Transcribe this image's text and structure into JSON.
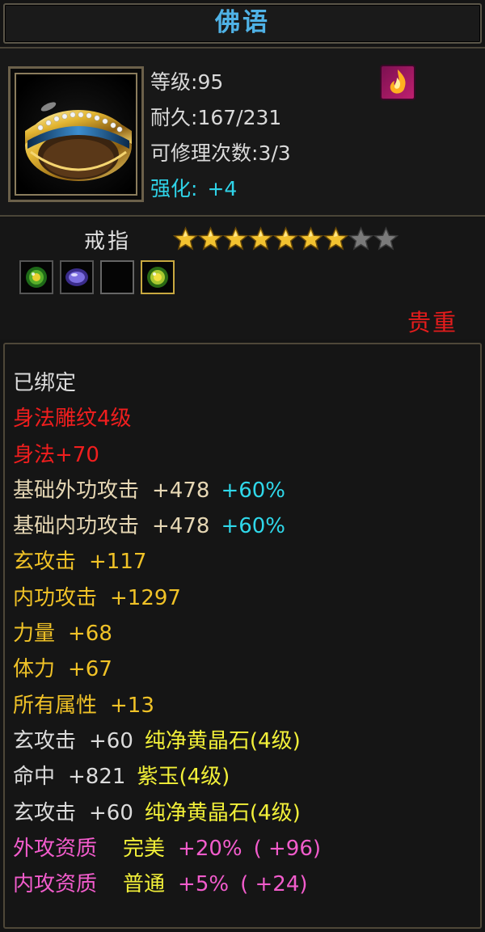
{
  "title": "佛语",
  "icons": {
    "item": "gold-ring-icon",
    "badge": "fire-skill-icon",
    "star_filled": "gold-star-icon",
    "star_empty": "gray-star-icon"
  },
  "stats": {
    "level_label": "等级",
    "level_value": "95",
    "durability_label": "耐久",
    "durability_value": "167/231",
    "repair_label": "可修理次数",
    "repair_value": "3/3",
    "enhance_label": "强化:",
    "enhance_value": "+4"
  },
  "item_type": "戒指",
  "stars": {
    "filled": 7,
    "total": 9
  },
  "gem_slots": [
    {
      "kind": "green-gem",
      "state": "filled"
    },
    {
      "kind": "purple-gem",
      "state": "filled"
    },
    {
      "kind": "none",
      "state": "empty"
    },
    {
      "kind": "yellow-gem",
      "state": "filled"
    }
  ],
  "quality": "贵重",
  "attributes": {
    "bound": "已绑定",
    "engrave_title": "身法雕纹4级",
    "engrave_bonus": "身法+70",
    "base_ext_atk": {
      "label": "基础外功攻击",
      "value": "+478",
      "extra": "+60%"
    },
    "base_int_atk": {
      "label": "基础内功攻击",
      "value": "+478",
      "extra": "+60%"
    },
    "xuan_atk": {
      "label": "玄攻击",
      "value": "+117"
    },
    "int_atk": {
      "label": "内功攻击",
      "value": "+1297"
    },
    "strength": {
      "label": "力量",
      "value": "+68"
    },
    "stamina": {
      "label": "体力",
      "value": "+67"
    },
    "all_attr": {
      "label": "所有属性",
      "value": "+13"
    },
    "gem1": {
      "label": "玄攻击",
      "value": "+60",
      "gem": "纯净黄晶石(4级)"
    },
    "gem2": {
      "label": "命中",
      "value": "+821",
      "gem": "紫玉(4级)"
    },
    "gem3": {
      "label": "玄攻击",
      "value": "+60",
      "gem": "纯净黄晶石(4级)"
    },
    "apt_ext": {
      "label": "外攻资质",
      "grade": "完美",
      "value": "+20%",
      "bonus": "( +96)"
    },
    "apt_int": {
      "label": "内攻资质",
      "grade": "普通",
      "value": "+5%",
      "bonus": "( +24)"
    }
  },
  "colors": {
    "title": "#4fb2e6",
    "enhance": "#2fd3e8",
    "quality": "#e51c1c",
    "engrave": "#f01e1e",
    "base_attr": "#e6d7b4",
    "percent": "#2fd8ea",
    "main_attr": "#f0c227",
    "gem_name": "#f2f039",
    "aptitude": "#f25ccc"
  }
}
